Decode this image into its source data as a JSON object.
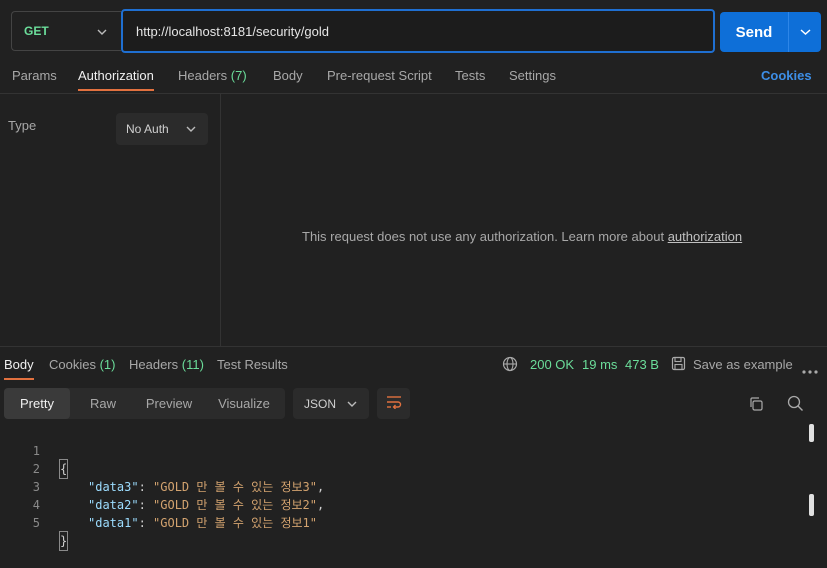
{
  "request": {
    "method": "GET",
    "url": "http://localhost:8181/security/gold",
    "send_label": "Send"
  },
  "request_tabs": {
    "params": "Params",
    "authorization": "Authorization",
    "headers": "Headers",
    "headers_count": "(7)",
    "body": "Body",
    "prerequest": "Pre-request Script",
    "tests": "Tests",
    "settings": "Settings",
    "cookies": "Cookies"
  },
  "auth": {
    "type_label": "Type",
    "type_value": "No Auth",
    "message": "This request does not use any authorization. Learn more about",
    "message_link": "authorization"
  },
  "response_tabs": {
    "body": "Body",
    "cookies": "Cookies",
    "cookies_count": "(1)",
    "headers": "Headers",
    "headers_count": "(11)",
    "test_results": "Test Results"
  },
  "response_status": {
    "status": "200 OK",
    "time": "19 ms",
    "size": "473 B",
    "save_example": "Save as example"
  },
  "view_modes": {
    "pretty": "Pretty",
    "raw": "Raw",
    "preview": "Preview",
    "visualize": "Visualize",
    "format": "JSON"
  },
  "code_lines": [
    {
      "num": "1",
      "open": "{"
    },
    {
      "num": "2",
      "key": "\"data3\"",
      "colon": ": ",
      "value": "\"GOLD 만 볼 수 있는 정보3\"",
      "comma": ","
    },
    {
      "num": "3",
      "key": "\"data2\"",
      "colon": ": ",
      "value": "\"GOLD 만 볼 수 있는 정보2\"",
      "comma": ","
    },
    {
      "num": "4",
      "key": "\"data1\"",
      "colon": ": ",
      "value": "\"GOLD 만 볼 수 있는 정보1\"",
      "comma": ""
    },
    {
      "num": "5",
      "close": "}"
    }
  ],
  "colors": {
    "accent_blue": "#0e6fd8",
    "method_green": "#6bdd9a",
    "tab_underline": "#e2713f"
  }
}
